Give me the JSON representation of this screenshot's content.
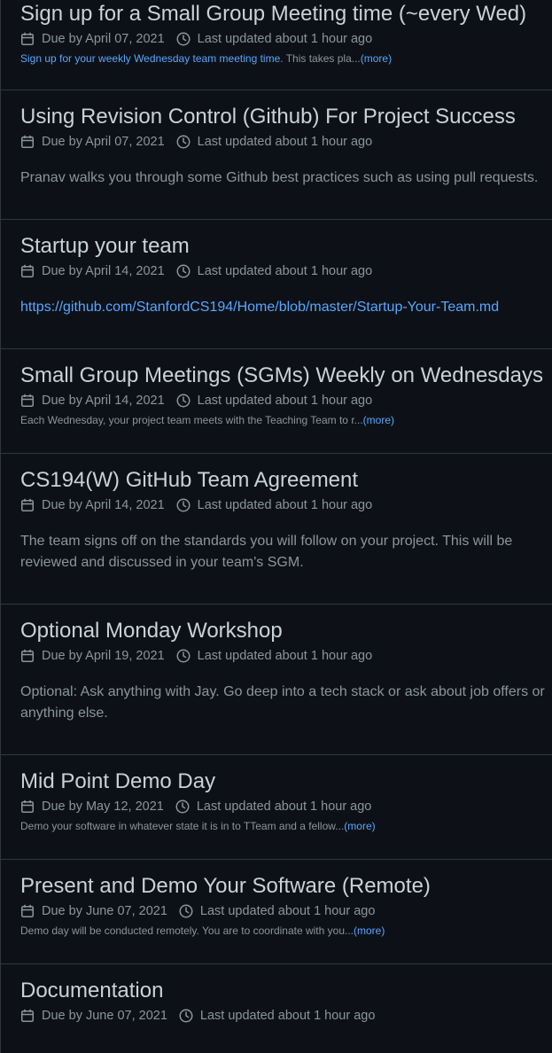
{
  "milestones": [
    {
      "title": "Sign up for a Small Group Meeting time (~every Wed)",
      "due": "Due by April 07, 2021",
      "updated": "Last updated about 1 hour ago",
      "desc_link": "Sign up for your weekly Wednesday team meeting time",
      "desc_text": ". This takes pla...",
      "more": "(more)"
    },
    {
      "title": "Using Revision Control (Github) For Project Success",
      "due": "Due by April 07, 2021",
      "updated": "Last updated about 1 hour ago",
      "desc": "Pranav walks you through some Github best practices such as using pull requests."
    },
    {
      "title": "Startup your team",
      "due": "Due by April 14, 2021",
      "updated": "Last updated about 1 hour ago",
      "desc_link": "https://github.com/StanfordCS194/Home/blob/master/Startup-Your-Team.md"
    },
    {
      "title": "Small Group Meetings (SGMs) Weekly on Wednesdays",
      "due": "Due by April 14, 2021",
      "updated": "Last updated about 1 hour ago",
      "desc_text": "Each Wednesday, your project team meets with the Teaching Team to r...",
      "more": "(more)"
    },
    {
      "title": "CS194(W) GitHub Team Agreement",
      "due": "Due by April 14, 2021",
      "updated": "Last updated about 1 hour ago",
      "desc": "The team signs off on the standards you will follow on your project. This will be reviewed and discussed in your team's SGM."
    },
    {
      "title": "Optional Monday Workshop",
      "due": "Due by April 19, 2021",
      "updated": "Last updated about 1 hour ago",
      "desc": "Optional: Ask anything with Jay. Go deep into a tech stack or ask about job offers or anything else."
    },
    {
      "title": "Mid Point Demo Day",
      "due": "Due by May 12, 2021",
      "updated": "Last updated about 1 hour ago",
      "desc_text": "Demo your software in whatever state it is in to TTeam and a fellow...",
      "more": "(more)"
    },
    {
      "title": "Present and Demo Your Software (Remote)",
      "due": "Due by June 07, 2021",
      "updated": "Last updated about 1 hour ago",
      "desc_text": "Demo day will be conducted remotely. You are to coordinate with you...",
      "more": "(more)"
    },
    {
      "title": "Documentation",
      "due": "Due by June 07, 2021",
      "updated": "Last updated about 1 hour ago"
    }
  ],
  "icons": {
    "calendar": "calendar-icon",
    "clock": "clock-icon"
  },
  "colors": {
    "background": "#0d1117",
    "border": "#30363d",
    "title": "#c9d1d9",
    "muted": "#8b949e",
    "link": "#58a6ff"
  }
}
